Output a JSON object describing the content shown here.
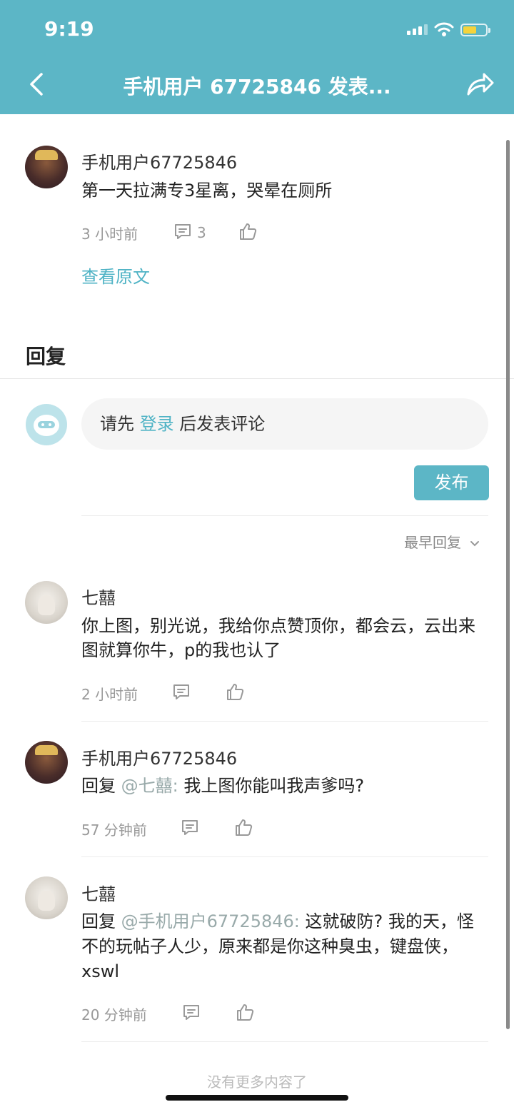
{
  "status": {
    "time": "9:19"
  },
  "header": {
    "title": "手机用户 67725846 发表..."
  },
  "post": {
    "user": "手机用户67725846",
    "content": "第一天拉满专3星离，哭晕在厕所",
    "time": "3 小时前",
    "comment_count": "3",
    "view_original": "查看原文"
  },
  "reply_section": {
    "title": "回复",
    "prompt_prefix": "请先",
    "login": "登录",
    "prompt_suffix": "后发表评论",
    "publish": "发布",
    "sort": "最早回复"
  },
  "comments": [
    {
      "user": "七囍",
      "reply_to": "",
      "text_line1": "你上图，别光说，我给你点赞顶你，都会云，云出来",
      "text_line2": "图就算你牛，p的我也认了",
      "text_line3": "",
      "time": "2 小时前"
    },
    {
      "user": "手机用户67725846",
      "reply_prefix": "回复",
      "reply_to": "@七囍:",
      "text_line1": "我上图你能叫我声爹吗?",
      "time": "57 分钟前"
    },
    {
      "user": "七囍",
      "reply_prefix": "回复",
      "reply_to": "@手机用户67725846:",
      "text_line1": "这就破防? 我的天，怪",
      "text_line2": "不的玩帖子人少，原来都是你这种臭虫，键盘侠，",
      "text_line3": "xswl",
      "time": "20 分钟前"
    }
  ],
  "footer": {
    "end_text": "没有更多内容了"
  },
  "colors": {
    "accent": "#5cb6c6",
    "link": "#4fb3c5"
  }
}
